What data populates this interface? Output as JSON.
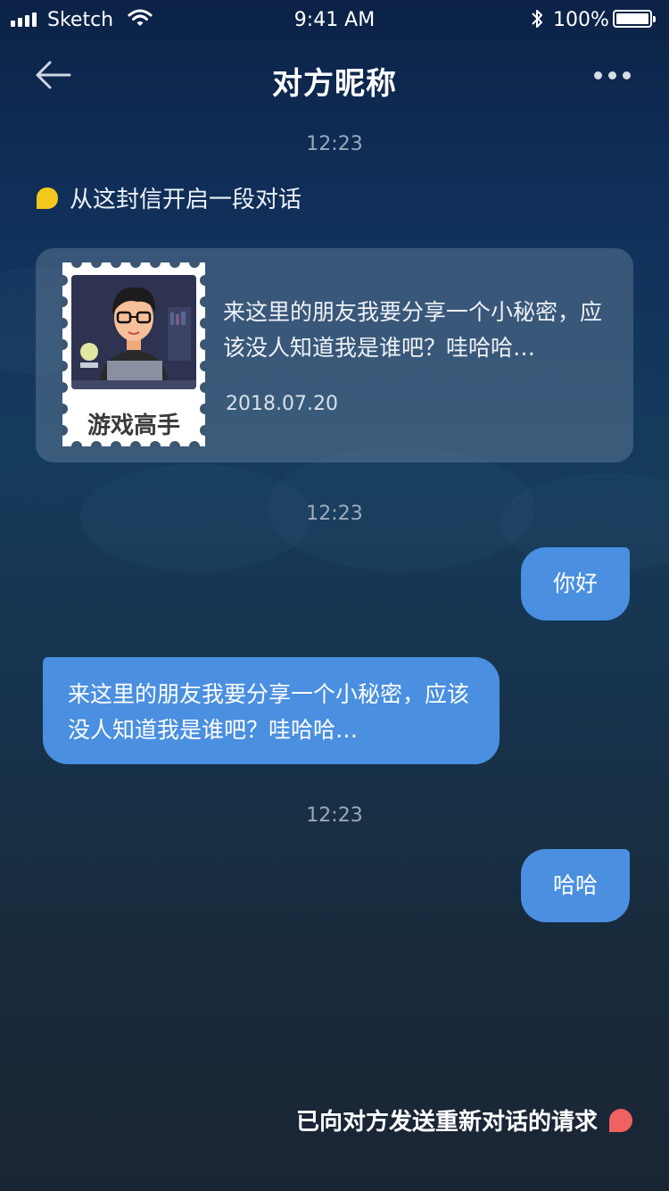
{
  "status_bar": {
    "carrier": "Sketch",
    "time": "9:41 AM",
    "battery": "100%"
  },
  "nav": {
    "title": "对方昵称"
  },
  "timestamps": [
    "12:23",
    "12:23",
    "12:23"
  ],
  "intro_text": "从这封信开启一段对话",
  "letter": {
    "stamp_label": "游戏高手",
    "text": "来这里的朋友我要分享一个小秘密，应该没人知道我是谁吧？哇哈哈…",
    "date": "2018.07.20"
  },
  "messages": [
    {
      "side": "right",
      "text": "你好"
    },
    {
      "side": "left",
      "text": "来这里的朋友我要分享一个小秘密，应该没人知道我是谁吧？哇哈哈…"
    },
    {
      "side": "right",
      "text": "哈哈"
    }
  ],
  "footer_status": "已向对方发送重新对话的请求",
  "colors": {
    "accent_blue": "#4a8fe0",
    "intro_dot": "#f5c81e",
    "status_dot": "#f06262"
  }
}
